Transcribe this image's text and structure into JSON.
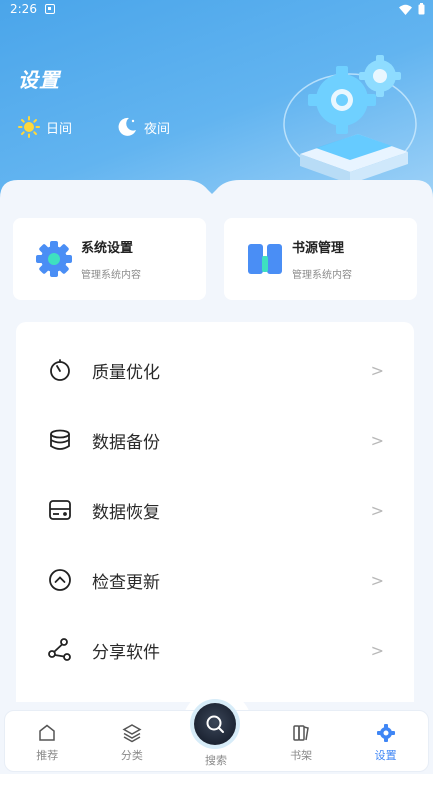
{
  "status_bar": {
    "time": "2:26"
  },
  "header": {
    "title": "设置",
    "modes": [
      {
        "label": "日间",
        "icon": "sun-icon"
      },
      {
        "label": "夜间",
        "icon": "moon-icon"
      }
    ]
  },
  "cards": [
    {
      "title": "系统设置",
      "subtitle": "管理系统内容",
      "icon": "gear-icon"
    },
    {
      "title": "书源管理",
      "subtitle": "管理系统内容",
      "icon": "book-icon"
    }
  ],
  "menu": [
    {
      "label": "质量优化",
      "icon": "timer-icon"
    },
    {
      "label": "数据备份",
      "icon": "database-icon"
    },
    {
      "label": "数据恢复",
      "icon": "drive-icon"
    },
    {
      "label": "检查更新",
      "icon": "update-icon"
    },
    {
      "label": "分享软件",
      "icon": "share-icon"
    }
  ],
  "tabbar": {
    "items": [
      {
        "label": "推荐",
        "icon": "home-icon"
      },
      {
        "label": "分类",
        "icon": "layers-icon"
      },
      {
        "label": "搜索",
        "icon": "search-icon"
      },
      {
        "label": "书架",
        "icon": "bookshelf-icon"
      },
      {
        "label": "设置",
        "icon": "settings-icon"
      }
    ],
    "active_color": "#3f86f5"
  },
  "colors": {
    "accent": "#3f86f5",
    "header": "#4aa5ea"
  }
}
